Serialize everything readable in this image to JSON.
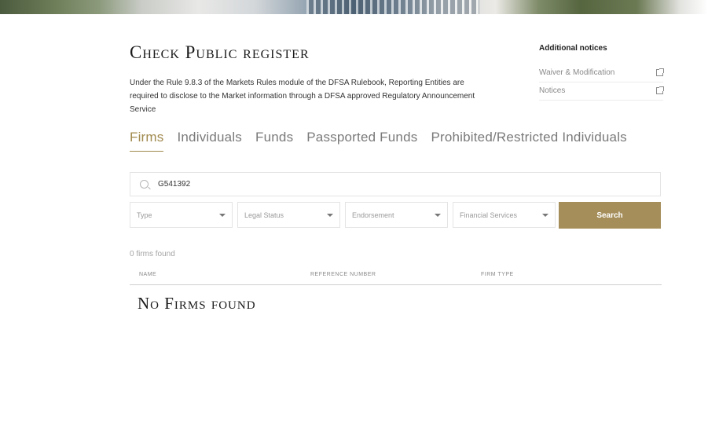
{
  "page": {
    "title": "Check Public register",
    "intro": "Under the Rule 9.8.3 of the Markets Rules module of the DFSA Rulebook, Reporting Entities are required to disclose to the Market information through a DFSA approved Regulatory Announcement Service"
  },
  "notices": {
    "heading": "Additional notices",
    "links": [
      {
        "label": "Waiver & Modification",
        "icon": "external-link-icon"
      },
      {
        "label": "Notices",
        "icon": "external-link-icon"
      }
    ]
  },
  "tabs": [
    {
      "label": "Firms",
      "active": true
    },
    {
      "label": "Individuals",
      "active": false
    },
    {
      "label": "Funds",
      "active": false
    },
    {
      "label": "Passported Funds",
      "active": false
    },
    {
      "label": "Prohibited/Restricted Individuals",
      "active": false
    }
  ],
  "search": {
    "value": "G541392",
    "icon": "search-icon",
    "button_label": "Search"
  },
  "filters": [
    {
      "label": "Type"
    },
    {
      "label": "Legal Status"
    },
    {
      "label": "Endorsement"
    },
    {
      "label": "Financial Services"
    }
  ],
  "results": {
    "count_text": "0 firms found",
    "columns": [
      "NAME",
      "REFERENCE NUMBER",
      "FIRM TYPE"
    ],
    "empty_message": "No Firms found"
  },
  "colors": {
    "accent": "#a58e5a",
    "tab_active": "#a08a4e"
  }
}
